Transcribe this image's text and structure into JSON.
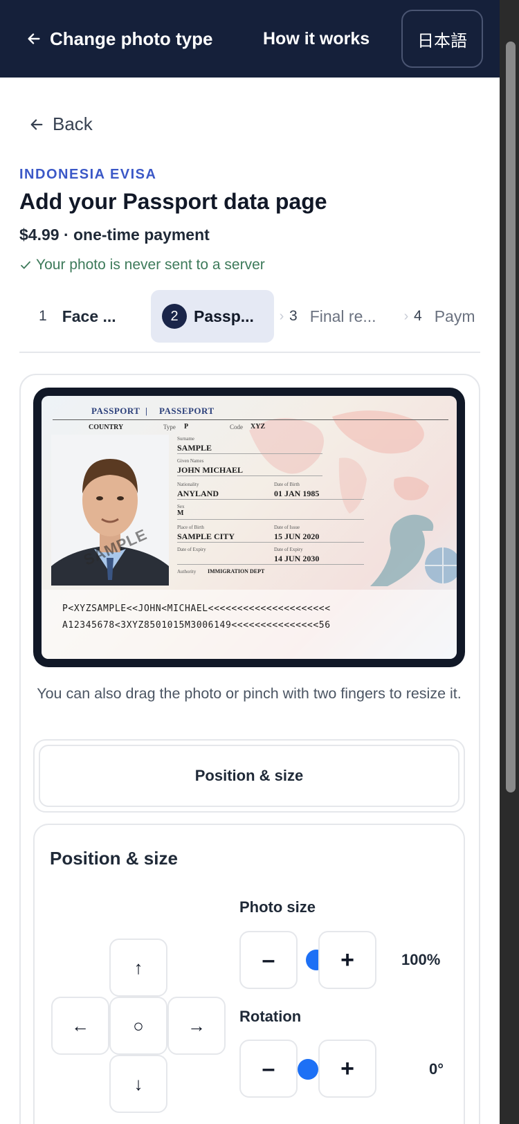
{
  "header": {
    "change_photo_label": "Change photo type",
    "how_it_works_label": "How it works",
    "language_label": "日本語"
  },
  "back_label": "Back",
  "page": {
    "kicker": "INDONESIA EVISA",
    "title": "Add your Passport data page",
    "price": "$4.99 · one-time payment",
    "privacy_note": "Your photo is never sent to a server"
  },
  "steps": [
    {
      "num": "1",
      "label": "Face ...",
      "state": "done"
    },
    {
      "num": "2",
      "label": "Passp...",
      "state": "active"
    },
    {
      "num": "3",
      "label": "Final re...",
      "state": "upcoming"
    },
    {
      "num": "4",
      "label": "Paym",
      "state": "upcoming"
    }
  ],
  "passport": {
    "header_left": "PASSPORT",
    "header_sep": "|",
    "header_right": "PASSEPORT",
    "country_label": "COUNTRY",
    "type_label": "Type",
    "type_value": "P",
    "code_label": "Code",
    "code_value": "XYZ",
    "surname_label": "Surname",
    "surname_value": "SAMPLE",
    "given_label": "Given Names",
    "given_value": "JOHN MICHAEL",
    "nationality_label": "Nationality",
    "nationality_value": "ANYLAND",
    "dob_label": "Date of Birth",
    "dob_value": "01 JAN 1985",
    "sex_label": "Sex",
    "sex_value": "M",
    "pob_label": "Place of Birth",
    "pob_value": "SAMPLE CITY",
    "doi_label": "Date of Issue",
    "doi_value": "15 JUN 2020",
    "doe_label": "Date of Expiry",
    "doe_label_left": "Date of Expiry",
    "doe_value": "14 JUN 2030",
    "authority_label": "Authority",
    "authority_value": "IMMIGRATION DEPT",
    "watermark": "SAMPLE",
    "mrz_line1": "P<XYZSAMPLE<<JOHN<MICHAEL<<<<<<<<<<<<<<<<<<<<<",
    "mrz_line2": "A12345678<3XYZ8501015M3006149<<<<<<<<<<<<<<<56"
  },
  "hint": "You can also drag the photo or pinch with two fingers to resize it.",
  "position_toggle_label": "Position & size",
  "panel": {
    "title": "Position & size",
    "photo_size_label": "Photo size",
    "photo_size_value": "100%",
    "rotation_label": "Rotation",
    "rotation_value": "0°",
    "minus_label": "–",
    "plus_label": "+",
    "dpad": {
      "up": "↑",
      "down": "↓",
      "left": "←",
      "right": "→",
      "center": "○"
    }
  },
  "colors": {
    "header_bg": "#15203a",
    "accent_blue": "#3b58c7",
    "slider_knob": "#1d70f5",
    "privacy_green": "#3d7a5a"
  }
}
